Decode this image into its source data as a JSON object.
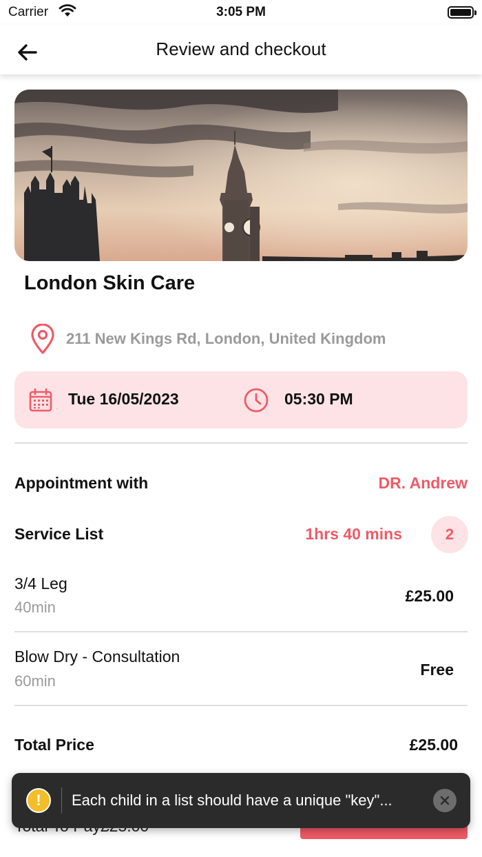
{
  "status_bar": {
    "carrier": "Carrier",
    "time": "3:05 PM"
  },
  "header": {
    "title": "Review and checkout",
    "back_icon": "arrow-left-icon"
  },
  "clinic": {
    "name": "London Skin Care",
    "address": "211 New Kings Rd, London, United Kingdom"
  },
  "booking": {
    "date": "Tue 16/05/2023",
    "time": "05:30 PM"
  },
  "appointment": {
    "label": "Appointment with",
    "doctor": "DR. Andrew"
  },
  "services": {
    "label": "Service List",
    "total_duration": "1hrs 40 mins",
    "count": "2",
    "items": [
      {
        "name": "3/4 Leg",
        "duration": "40min",
        "price": "£25.00"
      },
      {
        "name": "Blow Dry - Consultation",
        "duration": "60min",
        "price": "Free"
      }
    ]
  },
  "total": {
    "label": "Total Price",
    "value": "£25.00"
  },
  "footer": {
    "to_pay": "Total To Pay£25.00"
  },
  "toast": {
    "message": "Each child in a list should have a unique \"key\"..."
  },
  "colors": {
    "accent": "#f05a66",
    "accent_bg": "#fde3e5",
    "muted": "#9a9a9a",
    "toast_bg": "#2b2b2b",
    "warning": "#f4bd2a"
  }
}
